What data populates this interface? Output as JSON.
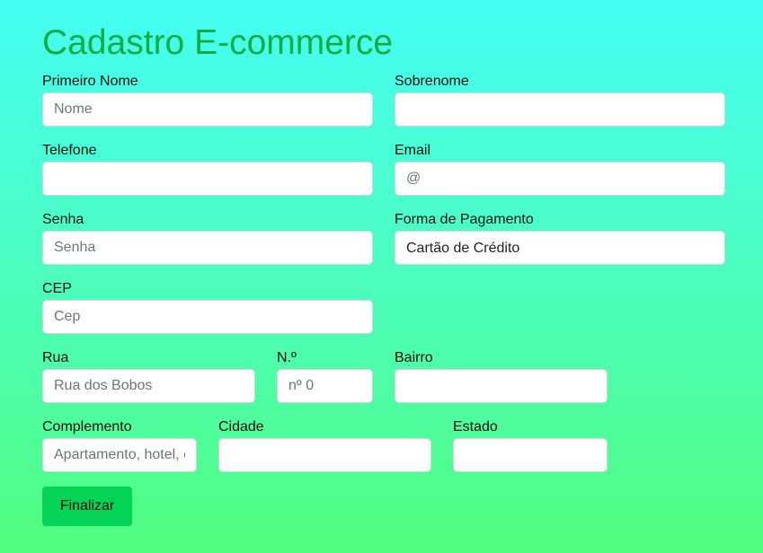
{
  "page": {
    "title": "Cadastro E-commerce"
  },
  "form": {
    "primeiro_nome": {
      "label": "Primeiro Nome",
      "placeholder": "Nome",
      "value": ""
    },
    "sobrenome": {
      "label": "Sobrenome",
      "placeholder": "",
      "value": ""
    },
    "telefone": {
      "label": "Telefone",
      "placeholder": "",
      "value": ""
    },
    "email": {
      "label": "Email",
      "placeholder": "@",
      "value": ""
    },
    "senha": {
      "label": "Senha",
      "placeholder": "Senha",
      "value": ""
    },
    "forma_pagamento": {
      "label": "Forma de Pagamento",
      "selected": "Cartão de Crédito"
    },
    "cep": {
      "label": "CEP",
      "placeholder": "Cep",
      "value": ""
    },
    "rua": {
      "label": "Rua",
      "placeholder": "Rua dos Bobos",
      "value": ""
    },
    "numero": {
      "label": "N.º",
      "placeholder": "nº 0",
      "value": ""
    },
    "bairro": {
      "label": "Bairro",
      "placeholder": "",
      "value": ""
    },
    "complemento": {
      "label": "Complemento",
      "placeholder": "Apartamento, hotel, casa",
      "value": ""
    },
    "cidade": {
      "label": "Cidade",
      "placeholder": "",
      "value": ""
    },
    "estado": {
      "label": "Estado",
      "placeholder": "",
      "value": ""
    },
    "submit_label": "Finalizar"
  },
  "colors": {
    "title": "#0fae43",
    "button": "#05d356",
    "background_top": "#45fef3",
    "background_bottom": "#52fd7f"
  }
}
